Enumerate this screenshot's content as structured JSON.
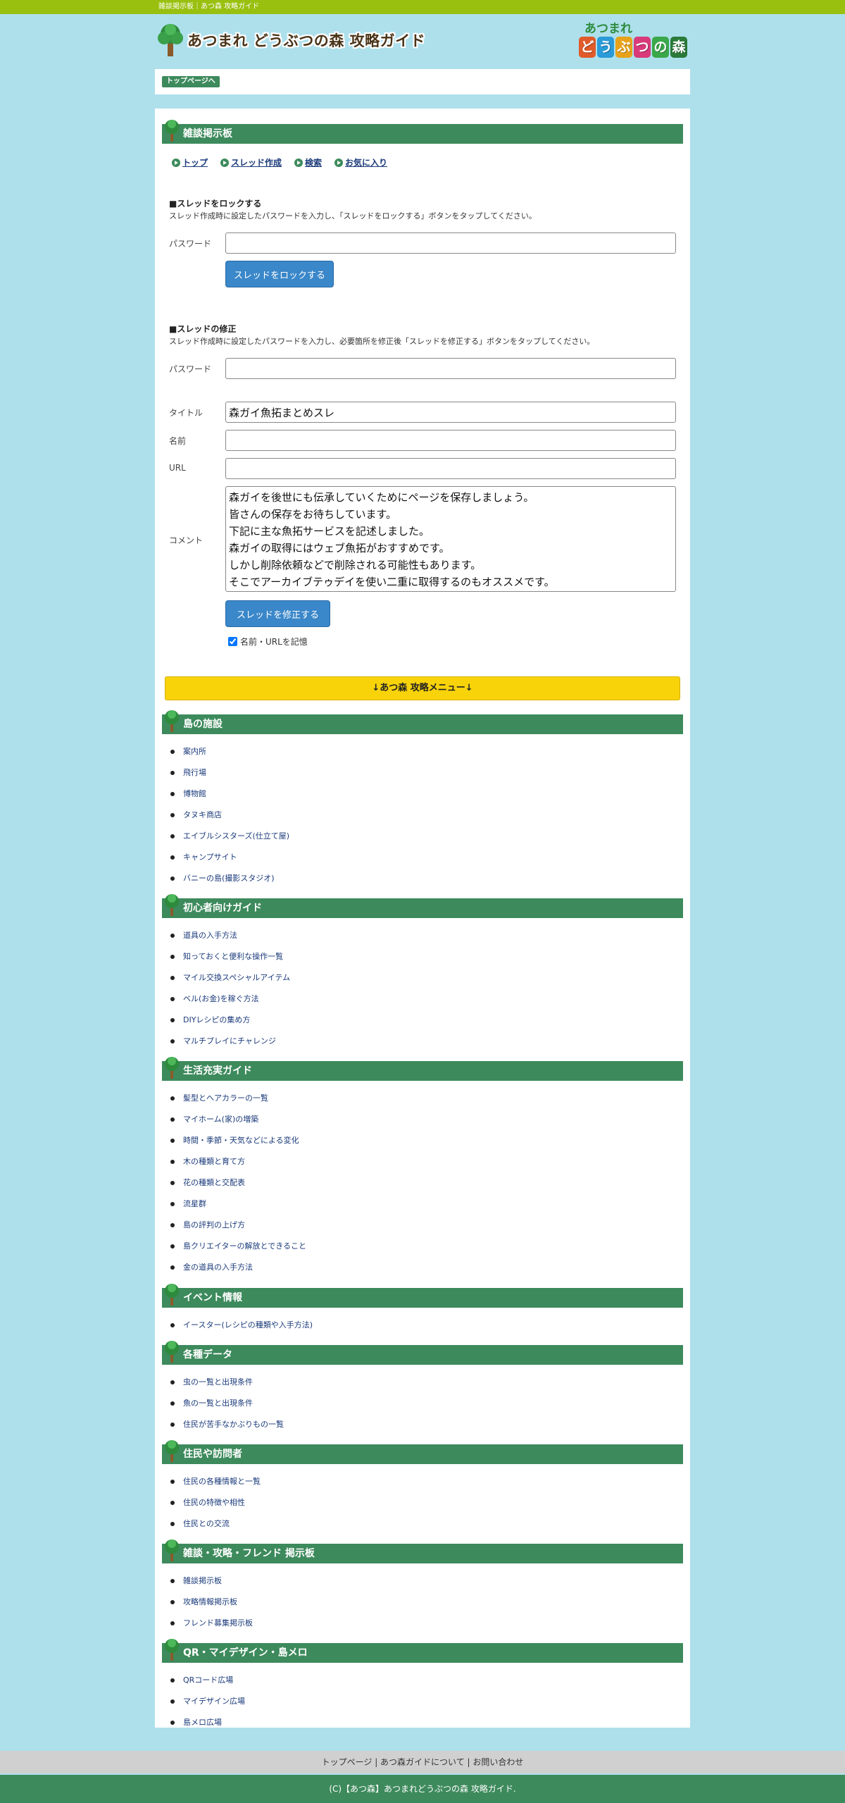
{
  "topbar": {
    "text": "雑談掲示板｜あつ森 攻略ガイド"
  },
  "header": {
    "site_title": "あつまれ どうぶつの森 攻略ガイド",
    "logo_top": "あつまれ",
    "logo_chars": [
      "ど",
      "う",
      "ぶ",
      "つ",
      "の",
      "森"
    ],
    "logo_colors": [
      "#e05a2a",
      "#2a9ad8",
      "#e8a21a",
      "#d83a7a",
      "#3aa84a",
      "#2a7a3a"
    ]
  },
  "breadcrumb": {
    "top_label": "トップページへ"
  },
  "board": {
    "title": "雑談掲示板",
    "nav": [
      {
        "label": "トップ"
      },
      {
        "label": "スレッド作成"
      },
      {
        "label": "検索"
      },
      {
        "label": "お気に入り"
      }
    ]
  },
  "lock_form": {
    "title": "■スレッドをロックする",
    "desc": "スレッド作成時に設定したパスワードを入力し、「スレッドをロックする」ボタンをタップしてください。",
    "password_label": "パスワード",
    "password_value": "",
    "submit_label": "スレッドをロックする"
  },
  "edit_form": {
    "title": "■スレッドの修正",
    "desc": "スレッド作成時に設定したパスワードを入力し、必要箇所を修正後「スレッドを修正する」ボタンをタップしてください。",
    "password_label": "パスワード",
    "password_value": "",
    "title_label": "タイトル",
    "title_value": "森ガイ魚拓まとめスレ",
    "name_label": "名前",
    "name_value": "",
    "url_label": "URL",
    "url_value": "",
    "comment_label": "コメント",
    "comment_value": "森ガイを後世にも伝承していくためにページを保存しましょう。\n皆さんの保存をお待ちしています。\n下記に主な魚拓サービスを記述しました。\n森ガイの取得にはウェブ魚拓がおすすめです。\nしかし削除依頼などで削除される可能性もあります。\nそこでアーカイブテゥデイを使い二重に取得するのもオススメです。",
    "submit_label": "スレッドを修正する",
    "remember_label": "名前・URLを記憶",
    "remember_checked": true
  },
  "menu_bar": {
    "label": "↓あつ森 攻略メニュー↓"
  },
  "sections": [
    {
      "title": "島の施設",
      "items": [
        "案内所",
        "飛行場",
        "博物館",
        "タヌキ商店",
        "エイブルシスターズ(仕立て屋)",
        "キャンプサイト",
        "バニーの島(撮影スタジオ)"
      ]
    },
    {
      "title": "初心者向けガイド",
      "items": [
        "道具の入手方法",
        "知っておくと便利な操作一覧",
        "マイル交換スペシャルアイテム",
        "ベル(お金)を稼ぐ方法",
        "DIYレシピの集め方",
        "マルチプレイにチャレンジ"
      ]
    },
    {
      "title": "生活充実ガイド",
      "items": [
        "髪型とヘアカラーの一覧",
        "マイホーム(家)の増築",
        "時間・季節・天気などによる変化",
        "木の種類と育て方",
        "花の種類と交配表",
        "流星群",
        "島の評判の上げ方",
        "島クリエイターの解放とできること",
        "金の道具の入手方法"
      ]
    },
    {
      "title": "イベント情報",
      "items": [
        "イースター(レシピの種類や入手方法)"
      ]
    },
    {
      "title": "各種データ",
      "items": [
        "虫の一覧と出現条件",
        "魚の一覧と出現条件",
        "住民が苦手なかぶりもの一覧"
      ]
    },
    {
      "title": "住民や訪問者",
      "items": [
        "住民の各種情報と一覧",
        "住民の特徴や相性",
        "住民との交流"
      ]
    },
    {
      "title": "雑談・攻略・フレンド 掲示板",
      "items": [
        "雑談掲示板",
        "攻略情報掲示板",
        "フレンド募集掲示板"
      ]
    },
    {
      "title": "QR・マイデザイン・島メロ",
      "items": [
        "QRコード広場",
        "マイデザイン広場",
        "島メロ広場"
      ]
    }
  ],
  "footer": {
    "links": "トップページ | あつ森ガイドについて | お問い合わせ",
    "copyright": "(C)【あつ森】あつまれどうぶつの森 攻略ガイド."
  },
  "colors": {
    "background": "#aee0ec",
    "topbar": "#99c00f",
    "section_header": "#3d8a5c",
    "menu_bar": "#f8d30a",
    "button": "#3a87c9"
  },
  "icons": {
    "tree": "tree-icon",
    "nav_bullet": "play-circle-icon"
  }
}
